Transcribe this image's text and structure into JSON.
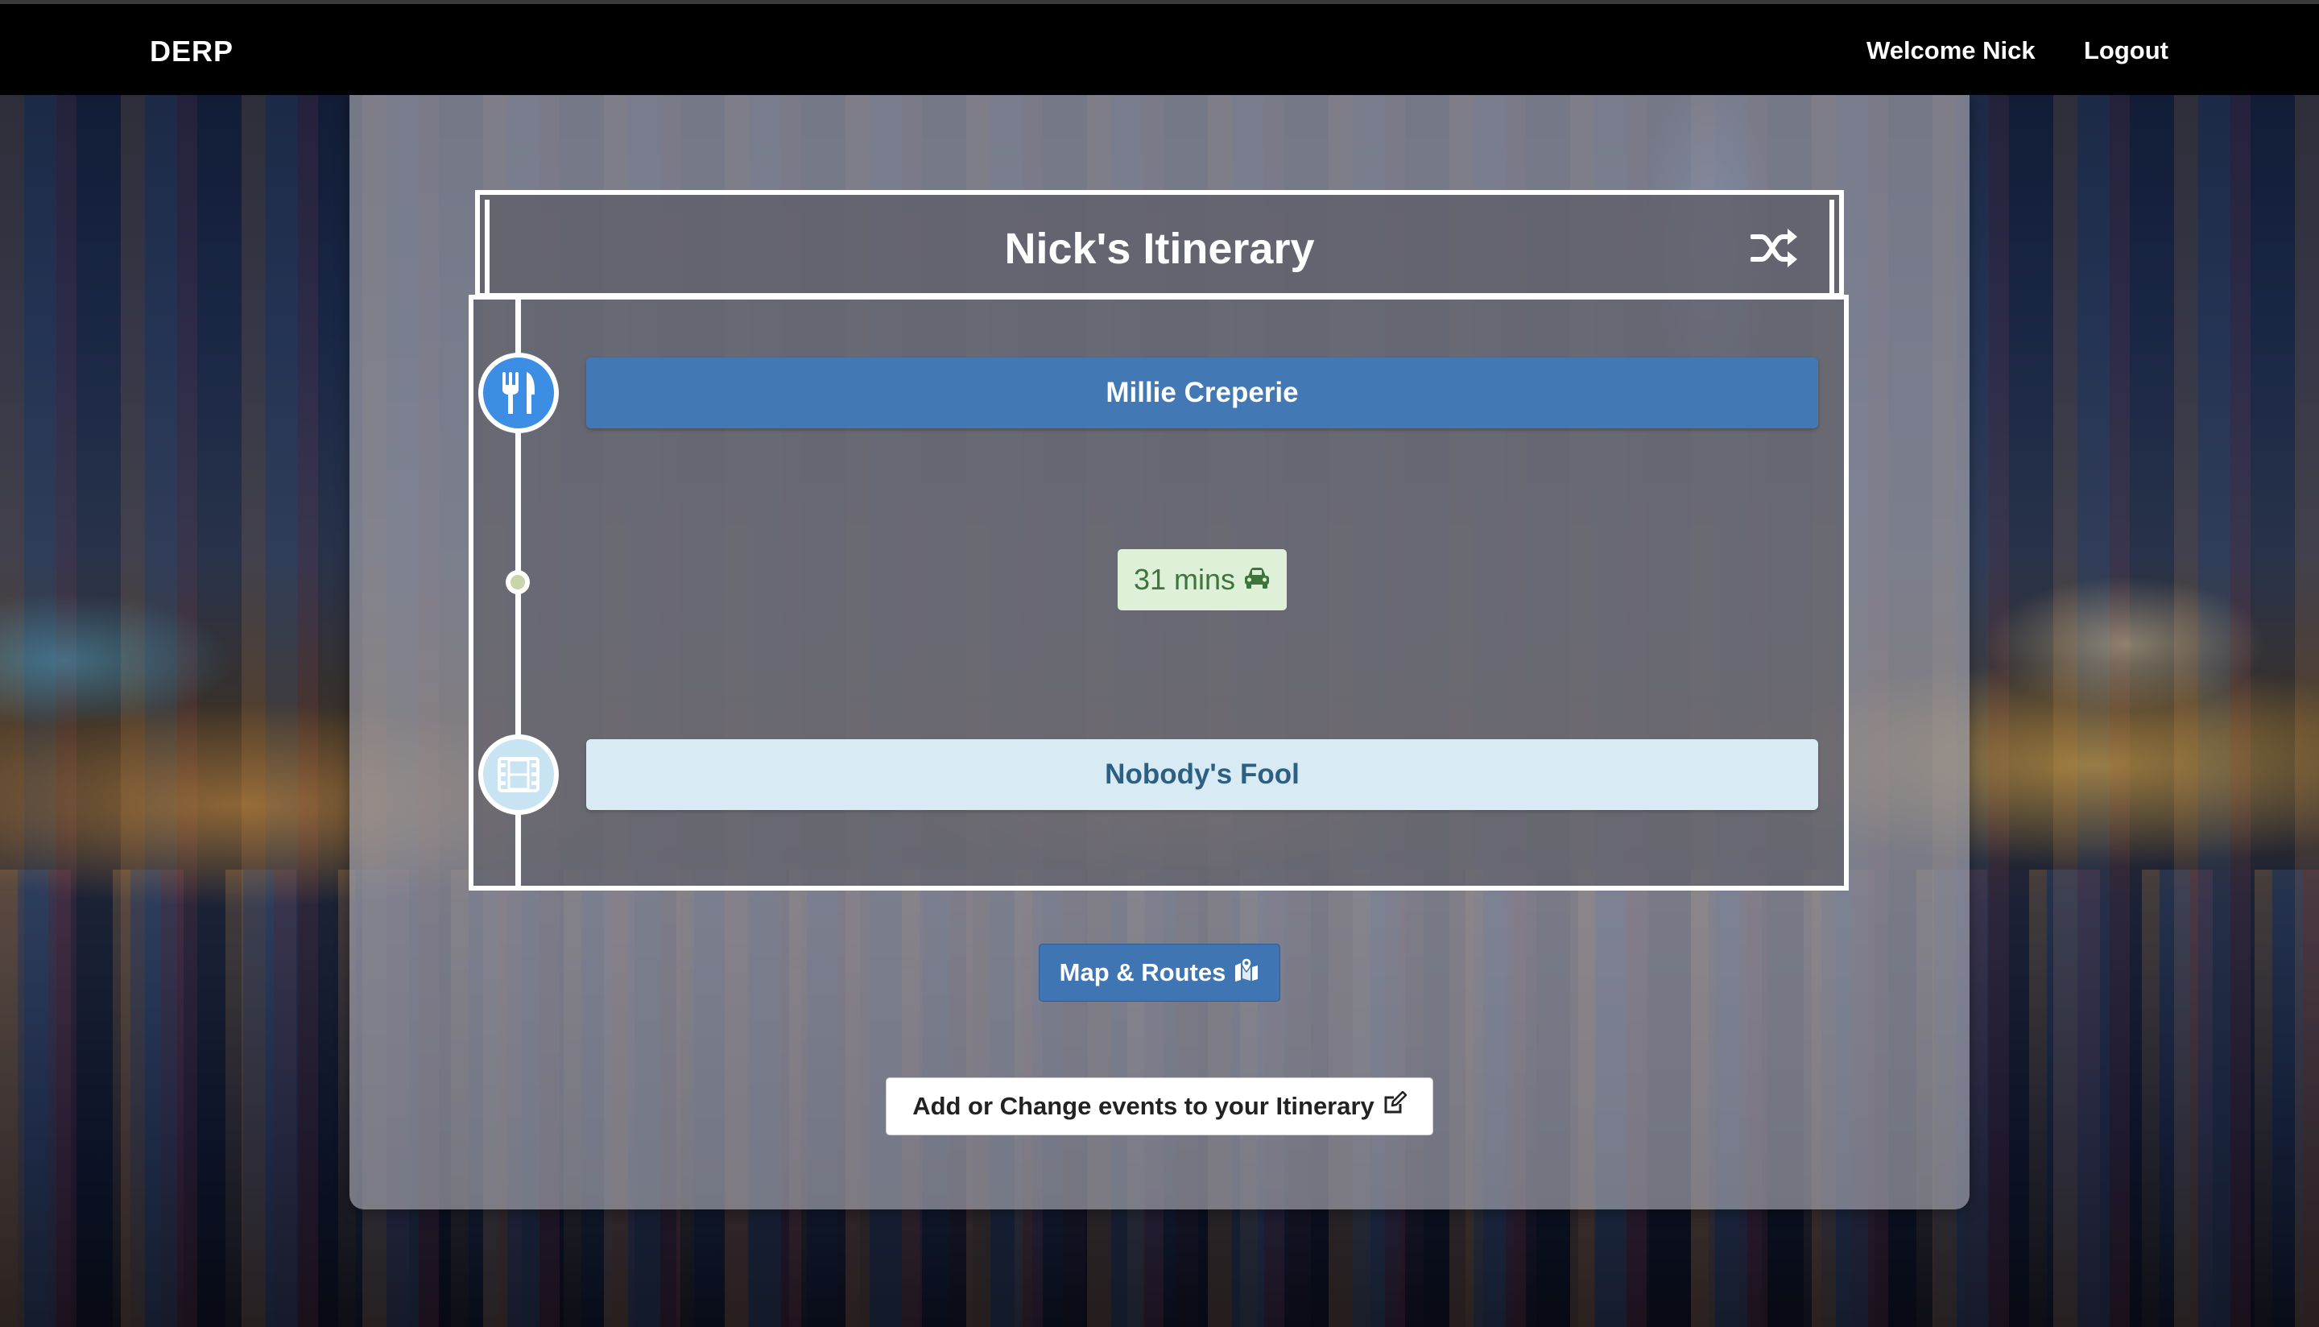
{
  "navbar": {
    "brand": "DERP",
    "welcome": "Welcome Nick",
    "logout": "Logout"
  },
  "itinerary": {
    "title": "Nick's Itinerary",
    "shuffle_icon": "shuffle-icon",
    "events": [
      {
        "name": "Millie Creperie",
        "icon": "utensils-icon",
        "color": "#4279b5"
      },
      {
        "name": "Nobody's Fool",
        "icon": "film-icon",
        "color": "#d8eaf4"
      }
    ],
    "travel": {
      "duration": "31 mins",
      "icon": "car-icon",
      "color": "#dff0d8"
    }
  },
  "actions": {
    "map_routes": "Map & Routes",
    "map_icon": "map-marked-icon",
    "edit_events": "Add or Change events to your Itinerary",
    "edit_icon": "edit-icon"
  },
  "colors": {
    "navbar": "#000000",
    "primary": "#3f75b2",
    "success_bg": "#dff0d8",
    "success_text": "#3c763d"
  }
}
